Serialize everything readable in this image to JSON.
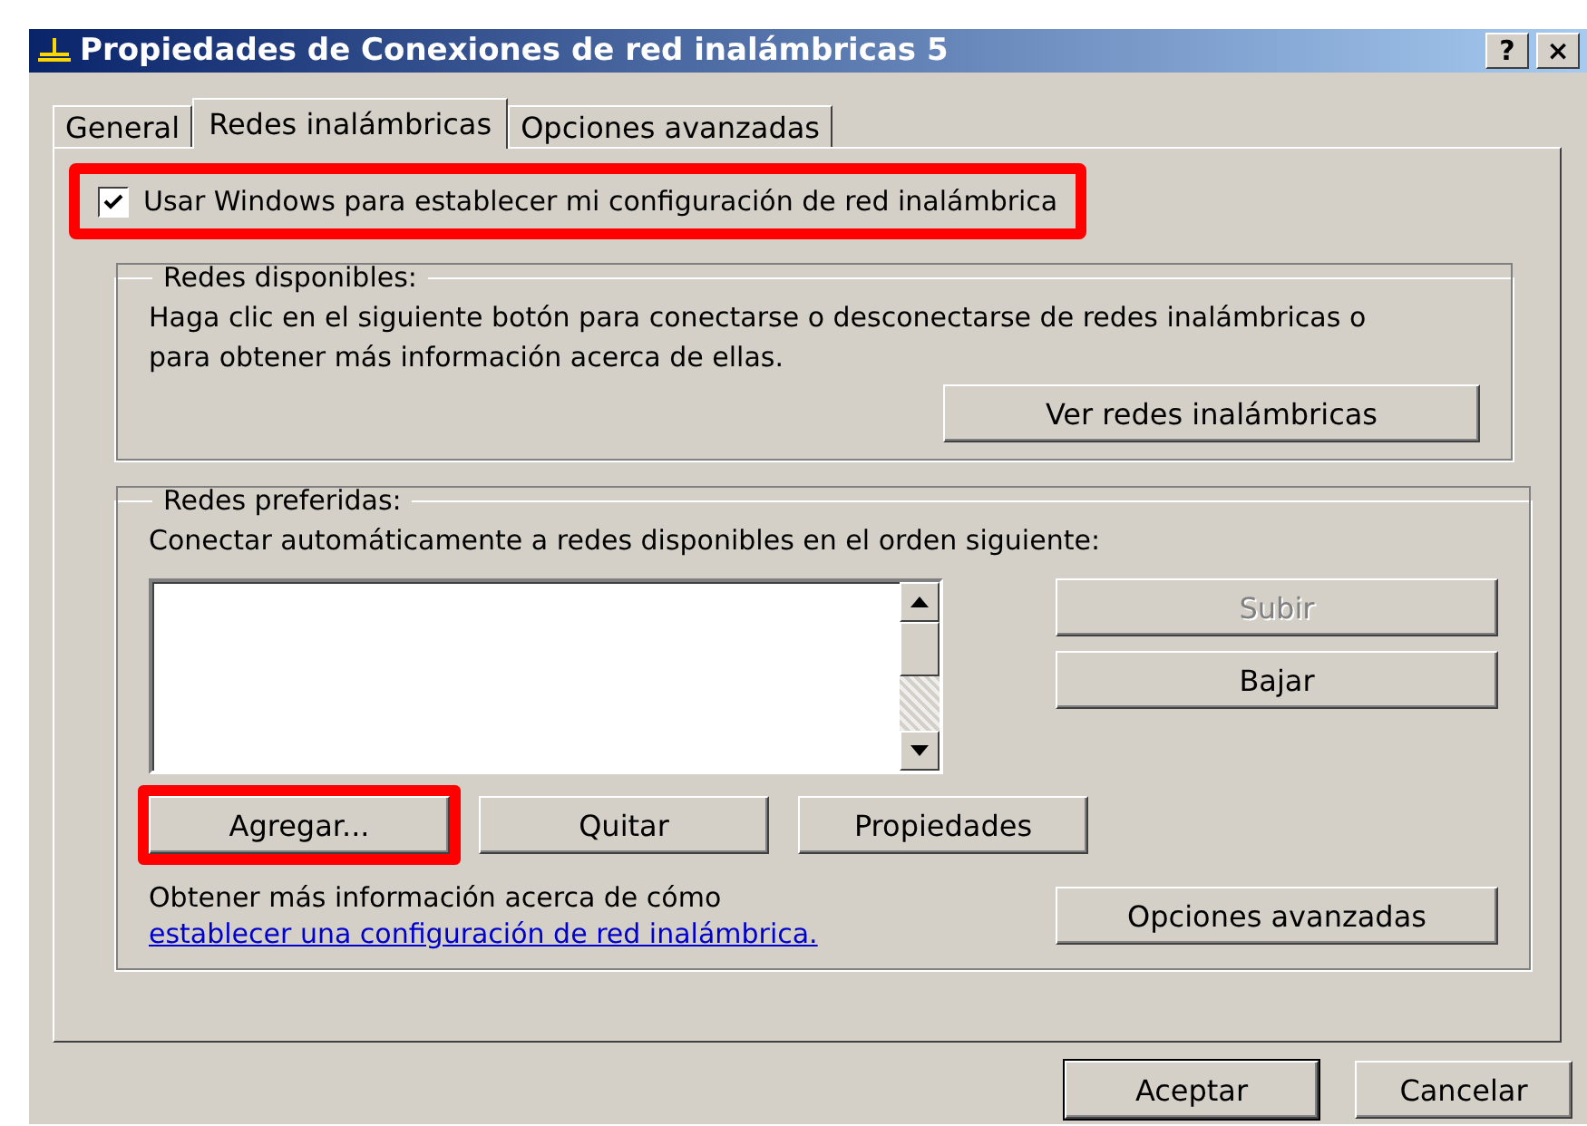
{
  "window": {
    "title": "Propiedades de Conexiones de red inalámbricas 5",
    "title_buttons": [
      "?",
      "×"
    ]
  },
  "tabs": [
    {
      "label": "General",
      "selected": false
    },
    {
      "label": "Redes inalámbricas",
      "selected": true
    },
    {
      "label": "Opciones avanzadas",
      "selected": false
    }
  ],
  "use_windows": {
    "label": "Usar Windows para establecer mi configuración de red inalámbrica",
    "checked": true,
    "highlighted": true
  },
  "available": {
    "legend": "Redes disponibles:",
    "text": "Haga clic en el siguiente botón para conectarse o desconectarse de redes inalámbricas o para obtener más información acerca de ellas.",
    "button": "Ver redes inalámbricas"
  },
  "preferred": {
    "legend": "Redes preferidas:",
    "text": "Conectar automáticamente a redes disponibles en el orden siguiente:",
    "side_buttons": [
      {
        "label": "Subir",
        "disabled": true
      },
      {
        "label": "Bajar",
        "disabled": false
      }
    ],
    "buttons": [
      {
        "label": "Agregar...",
        "highlighted": true
      },
      {
        "label": "Quitar",
        "highlighted": false
      },
      {
        "label": "Propiedades",
        "highlighted": false
      }
    ],
    "info_text": "Obtener más información acerca de cómo",
    "info_link": "establecer una configuración de red inalámbrica.",
    "advanced_button": "Opciones avanzadas"
  },
  "footer_buttons": [
    {
      "label": "Aceptar",
      "default": true
    },
    {
      "label": "Cancelar",
      "default": false
    }
  ]
}
